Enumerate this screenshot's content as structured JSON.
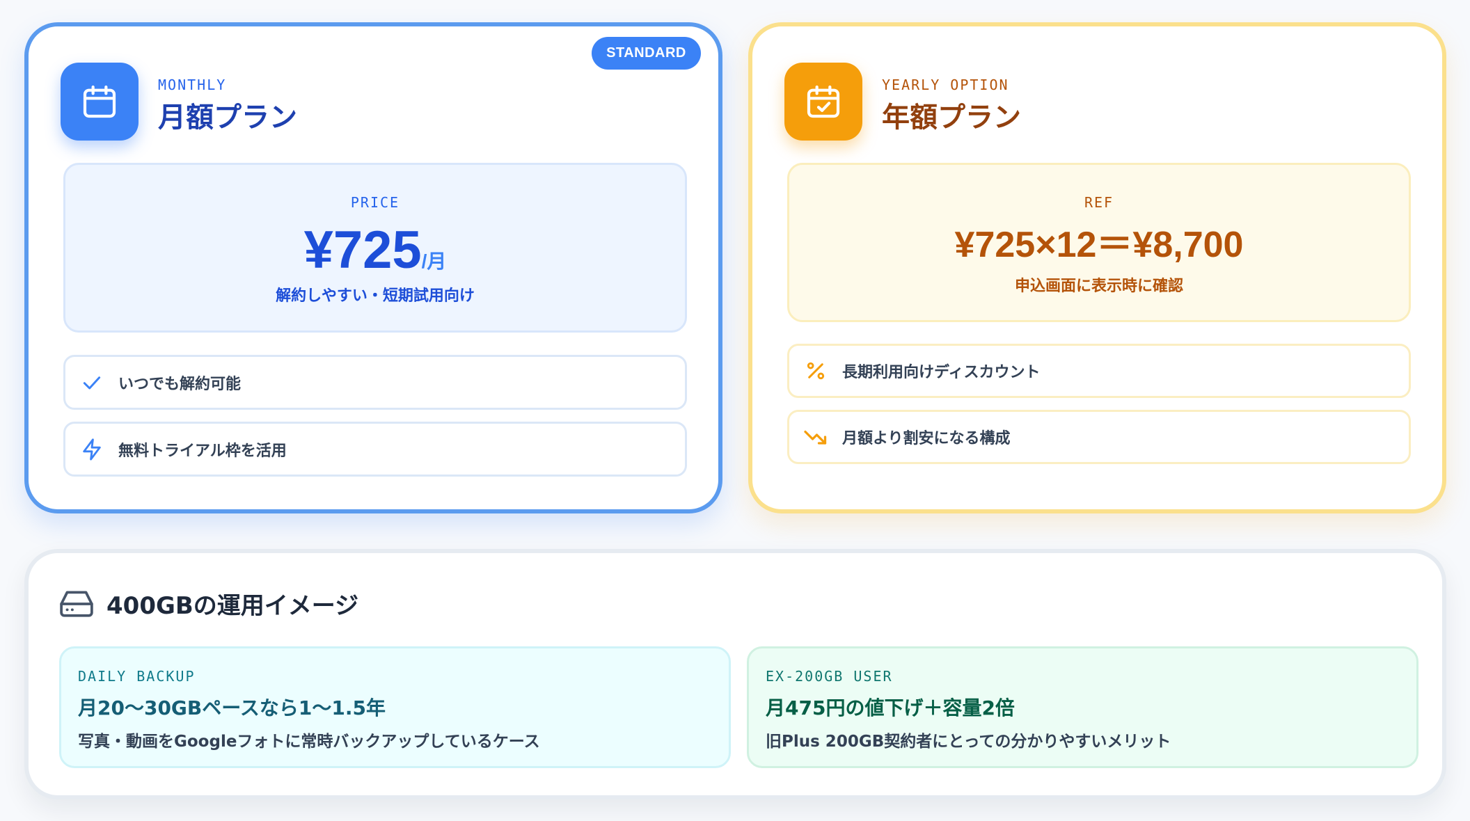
{
  "monthly": {
    "badge": "STANDARD",
    "eyebrow": "MONTHLY",
    "title": "月額プラン",
    "icon": "calendar-icon",
    "price_label": "PRICE",
    "price": "¥725",
    "price_unit": "/月",
    "price_note": "解約しやすい・短期試用向け",
    "features": [
      {
        "icon": "check-icon",
        "label": "いつでも解約可能"
      },
      {
        "icon": "lightning-icon",
        "label": "無料トライアル枠を活用"
      }
    ],
    "colors": {
      "accent": "#3b82f6",
      "border": "#5b9bef",
      "text": "#1e40af"
    }
  },
  "yearly": {
    "eyebrow": "YEARLY OPTION",
    "title": "年額プラン",
    "icon": "calendar-check-icon",
    "ref_label": "REF",
    "ref_formula": "¥725×12＝¥8,700",
    "ref_note": "申込画面に表示時に確認",
    "features": [
      {
        "icon": "percent-icon",
        "label": "長期利用向けディスカウント"
      },
      {
        "icon": "trending-down-icon",
        "label": "月額より割安になる構成"
      }
    ],
    "colors": {
      "accent": "#f59e0b",
      "border": "#fbe08c",
      "text": "#b45309"
    }
  },
  "usage": {
    "icon": "hard-drive-icon",
    "title": "400GBの運用イメージ",
    "cases": [
      {
        "eyebrow": "DAILY BACKUP",
        "title": "月20〜30GBペースなら1〜1.5年",
        "desc": "写真・動画をGoogleフォトに常時バックアップしているケース"
      },
      {
        "eyebrow": "EX-200GB USER",
        "title": "月475円の値下げ＋容量2倍",
        "desc": "旧Plus 200GB契約者にとっての分かりやすいメリット"
      }
    ]
  }
}
